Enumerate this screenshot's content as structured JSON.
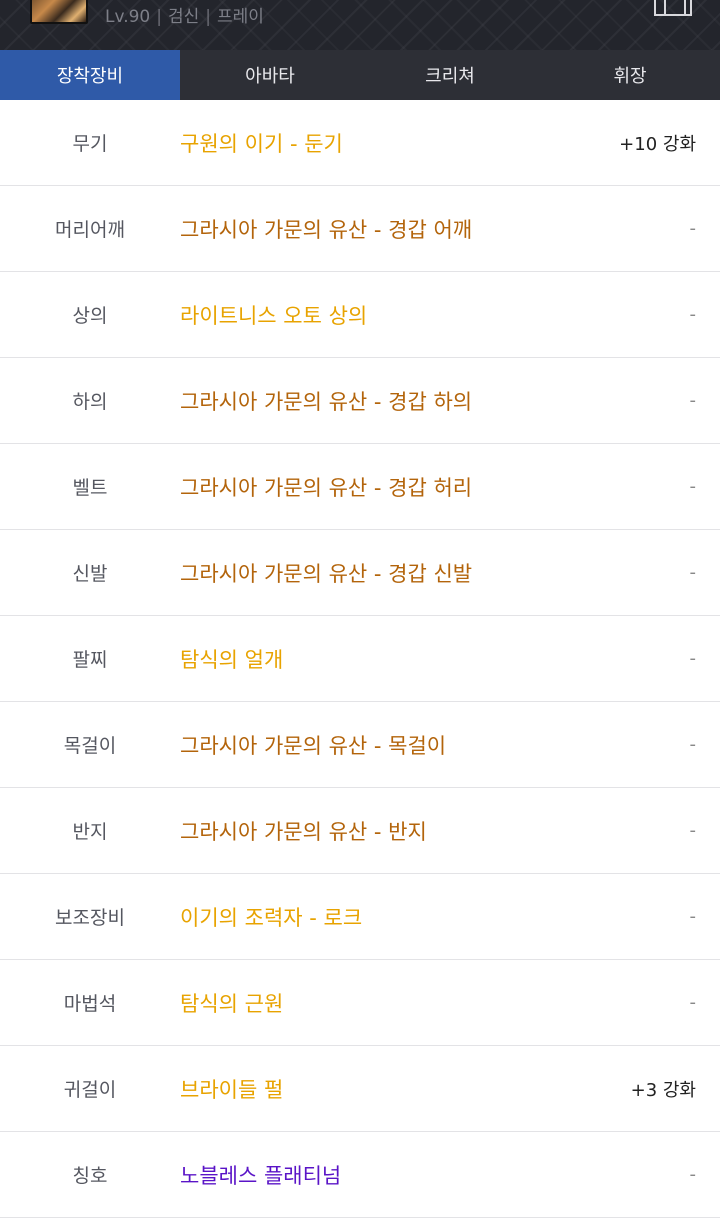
{
  "header": {
    "level": "Lv.90",
    "job": "검신",
    "server": "프레이"
  },
  "tabs": [
    {
      "label": "장착장비",
      "active": true
    },
    {
      "label": "아바타",
      "active": false
    },
    {
      "label": "크리쳐",
      "active": false
    },
    {
      "label": "휘장",
      "active": false
    }
  ],
  "colors": {
    "unique": "#e8a300",
    "legendary": "#b3640b",
    "epic": "#5a14c7",
    "tab_active": "#2f5aa8"
  },
  "equipment": [
    {
      "slot": "무기",
      "item": "구원의 이기 - 둔기",
      "rarity": "unique",
      "extra": "+10 강화"
    },
    {
      "slot": "머리어깨",
      "item": "그라시아 가문의 유산 - 경갑 어깨",
      "rarity": "legendary",
      "extra": "-"
    },
    {
      "slot": "상의",
      "item": "라이트니스 오토 상의",
      "rarity": "unique",
      "extra": "-"
    },
    {
      "slot": "하의",
      "item": "그라시아 가문의 유산 - 경갑 하의",
      "rarity": "legendary",
      "extra": "-"
    },
    {
      "slot": "벨트",
      "item": "그라시아 가문의 유산 - 경갑 허리",
      "rarity": "legendary",
      "extra": "-"
    },
    {
      "slot": "신발",
      "item": "그라시아 가문의 유산 - 경갑 신발",
      "rarity": "legendary",
      "extra": "-"
    },
    {
      "slot": "팔찌",
      "item": "탐식의 얼개",
      "rarity": "unique",
      "extra": "-"
    },
    {
      "slot": "목걸이",
      "item": "그라시아 가문의 유산 - 목걸이",
      "rarity": "legendary",
      "extra": "-"
    },
    {
      "slot": "반지",
      "item": "그라시아 가문의 유산 - 반지",
      "rarity": "legendary",
      "extra": "-"
    },
    {
      "slot": "보조장비",
      "item": "이기의 조력자 - 로크",
      "rarity": "unique",
      "extra": "-"
    },
    {
      "slot": "마법석",
      "item": "탐식의 근원",
      "rarity": "unique",
      "extra": "-"
    },
    {
      "slot": "귀걸이",
      "item": "브라이들 펄",
      "rarity": "unique",
      "extra": "+3 강화"
    },
    {
      "slot": "칭호",
      "item": "노블레스 플래티넘",
      "rarity": "epic",
      "extra": "-"
    }
  ]
}
